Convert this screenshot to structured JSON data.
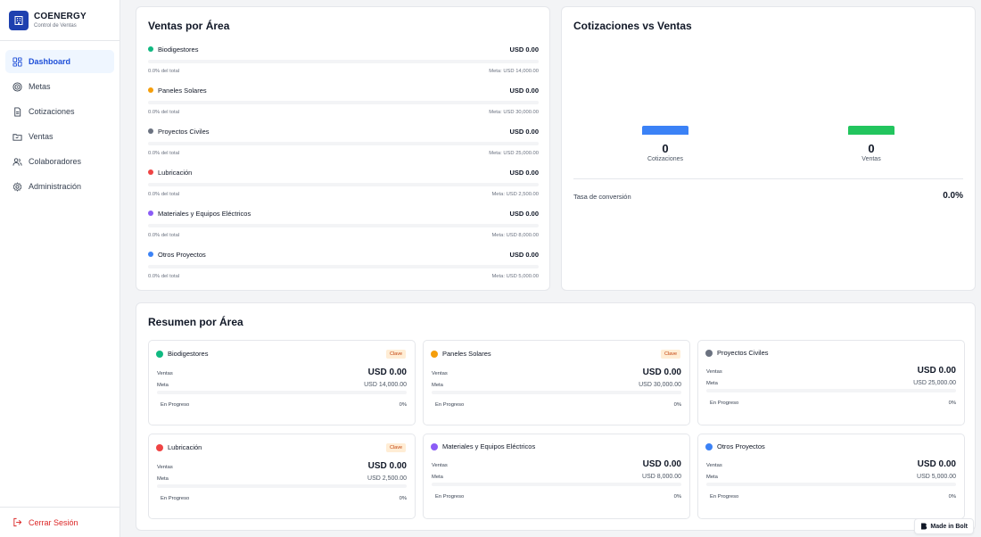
{
  "brand": {
    "name": "COENERGY",
    "subtitle": "Control de Ventas"
  },
  "nav": {
    "items": [
      {
        "label": "Dashboard",
        "icon": "dashboard-icon",
        "active": true
      },
      {
        "label": "Metas",
        "icon": "target-icon"
      },
      {
        "label": "Cotizaciones",
        "icon": "document-icon"
      },
      {
        "label": "Ventas",
        "icon": "folder-icon"
      },
      {
        "label": "Colaboradores",
        "icon": "users-icon"
      },
      {
        "label": "Administración",
        "icon": "gear-icon"
      }
    ],
    "logout": "Cerrar Sesión"
  },
  "ventas_por_area": {
    "title": "Ventas por Área",
    "areas": [
      {
        "name": "Biodigestores",
        "amount": "USD 0.00",
        "share": "0.0% del total",
        "meta": "Meta: USD 14,000.00",
        "color": "#10b981"
      },
      {
        "name": "Paneles Solares",
        "amount": "USD 0.00",
        "share": "0.0% del total",
        "meta": "Meta: USD 30,000.00",
        "color": "#f59e0b"
      },
      {
        "name": "Proyectos Civiles",
        "amount": "USD 0.00",
        "share": "0.0% del total",
        "meta": "Meta: USD 25,000.00",
        "color": "#6b7280"
      },
      {
        "name": "Lubricación",
        "amount": "USD 0.00",
        "share": "0.0% del total",
        "meta": "Meta: USD 2,500.00",
        "color": "#ef4444"
      },
      {
        "name": "Materiales y Equipos Eléctricos",
        "amount": "USD 0.00",
        "share": "0.0% del total",
        "meta": "Meta: USD 8,000.00",
        "color": "#8b5cf6"
      },
      {
        "name": "Otros Proyectos",
        "amount": "USD 0.00",
        "share": "0.0% del total",
        "meta": "Meta: USD 5,000.00",
        "color": "#3b82f6"
      }
    ]
  },
  "cotizaciones_vs_ventas": {
    "title": "Cotizaciones vs Ventas",
    "cotizaciones": {
      "value": "0",
      "label": "Cotizaciones",
      "color": "#3b82f6"
    },
    "ventas": {
      "value": "0",
      "label": "Ventas",
      "color": "#22c55e"
    },
    "conversion_label": "Tasa de conversión",
    "conversion_value": "0.0%"
  },
  "resumen": {
    "title": "Resumen por Área",
    "labels": {
      "ventas": "Ventas",
      "meta": "Meta",
      "status": "En Progreso"
    },
    "cards": [
      {
        "name": "Biodigestores",
        "badge": "Clave",
        "ventas": "USD 0.00",
        "meta": "USD 14,000.00",
        "pct": "0%",
        "color": "#10b981"
      },
      {
        "name": "Paneles Solares",
        "badge": "Clave",
        "ventas": "USD 0.00",
        "meta": "USD 30,000.00",
        "pct": "0%",
        "color": "#f59e0b"
      },
      {
        "name": "Proyectos Civiles",
        "badge": "",
        "ventas": "USD 0.00",
        "meta": "USD 25,000.00",
        "pct": "0%",
        "color": "#6b7280"
      },
      {
        "name": "Lubricación",
        "badge": "Clave",
        "ventas": "USD 0.00",
        "meta": "USD 2,500.00",
        "pct": "0%",
        "color": "#ef4444"
      },
      {
        "name": "Materiales y Equipos Eléctricos",
        "badge": "",
        "ventas": "USD 0.00",
        "meta": "USD 8,000.00",
        "pct": "0%",
        "color": "#8b5cf6"
      },
      {
        "name": "Otros Proyectos",
        "badge": "",
        "ventas": "USD 0.00",
        "meta": "USD 5,000.00",
        "pct": "0%",
        "color": "#3b82f6"
      }
    ]
  },
  "made_in_bolt": "Made in Bolt"
}
